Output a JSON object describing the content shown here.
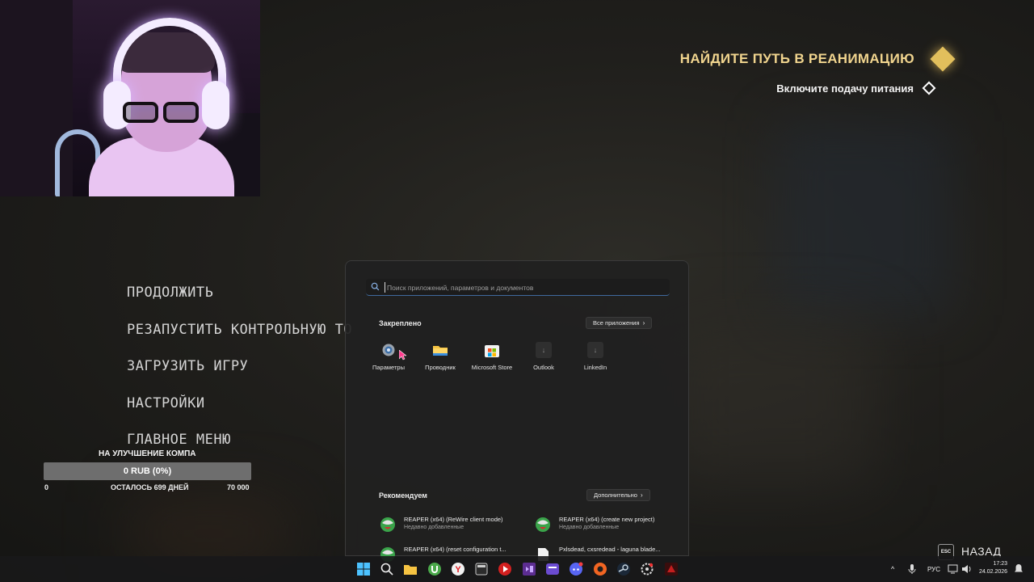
{
  "objective": {
    "title": "НАЙДИТЕ ПУТЬ В РЕАНИМАЦИЮ",
    "subtitle": "Включите подачу питания"
  },
  "pause_menu": {
    "items": [
      "ПРОДОЛЖИТЬ",
      "РЕЗАПУСТИТЬ КОНТРОЛЬНУЮ ТО",
      "ЗАГРУЗИТЬ ИГРУ",
      "НАСТРОЙКИ",
      "ГЛАВНОЕ МЕНЮ"
    ]
  },
  "donation": {
    "title": "НА УЛУЧШЕНИЕ КОМПА",
    "value_text": "0 RUB (0%)",
    "progress_fraction": 0,
    "min": "0",
    "remaining": "ОСТАЛОСЬ 699 ДНЕЙ",
    "max": "70 000",
    "fill_color": "#c9a54b"
  },
  "start_menu": {
    "search_placeholder": "Поиск приложений, параметров и документов",
    "pinned_title": "Закреплено",
    "all_apps_label": "Все приложения",
    "pinned_apps": [
      {
        "label": "Параметры",
        "icon": "settings-gear-icon"
      },
      {
        "label": "Проводник",
        "icon": "folder-icon"
      },
      {
        "label": "Microsoft Store",
        "icon": "store-icon"
      },
      {
        "label": "Outlook",
        "icon": "download-placeholder-icon"
      },
      {
        "label": "LinkedIn",
        "icon": "download-placeholder-icon"
      }
    ],
    "recommended_title": "Рекомендуем",
    "more_label": "Дополнительно",
    "recommended": [
      {
        "name": "REAPER (x64) (ReWire client mode)",
        "sub": "Недавно добавленные",
        "icon": "reaper-icon"
      },
      {
        "name": "REAPER (x64) (create new project)",
        "sub": "Недавно добавленные",
        "icon": "reaper-icon"
      },
      {
        "name": "REAPER (x64) (reset configuration t...",
        "sub": "",
        "icon": "reaper-icon"
      },
      {
        "name": "Pxlsdead, cxsredead - laguna blade...",
        "sub": "",
        "icon": "file-icon"
      }
    ]
  },
  "back": {
    "key": "ESC",
    "label": "НАЗАД"
  },
  "taskbar": {
    "language": "РУС",
    "time": "17:23",
    "date": "24.02.2026"
  },
  "colors": {
    "objective_gold": "#f0d48e",
    "accent_blue": "#3f6a9e"
  }
}
